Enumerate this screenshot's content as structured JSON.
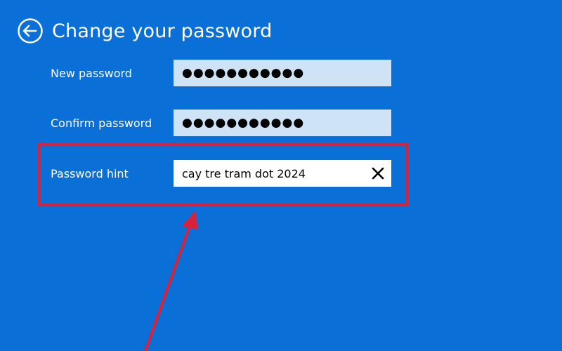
{
  "header": {
    "title": "Change your password",
    "back_icon": "back-arrow-icon"
  },
  "fields": {
    "new_password": {
      "label": "New password",
      "masked_value": "●●●●●●●●●●●"
    },
    "confirm_password": {
      "label": "Confirm password",
      "masked_value": "●●●●●●●●●●●"
    },
    "password_hint": {
      "label": "Password hint",
      "value": "cay tre tram dot 2024",
      "clear_icon": "close-icon"
    }
  },
  "annotation": {
    "highlight_color": "#d9213a",
    "arrow_color": "#d9213a"
  },
  "colors": {
    "background": "#0a6fd6",
    "masked_field_bg": "#cfe3f7",
    "active_field_bg": "#ffffff"
  }
}
